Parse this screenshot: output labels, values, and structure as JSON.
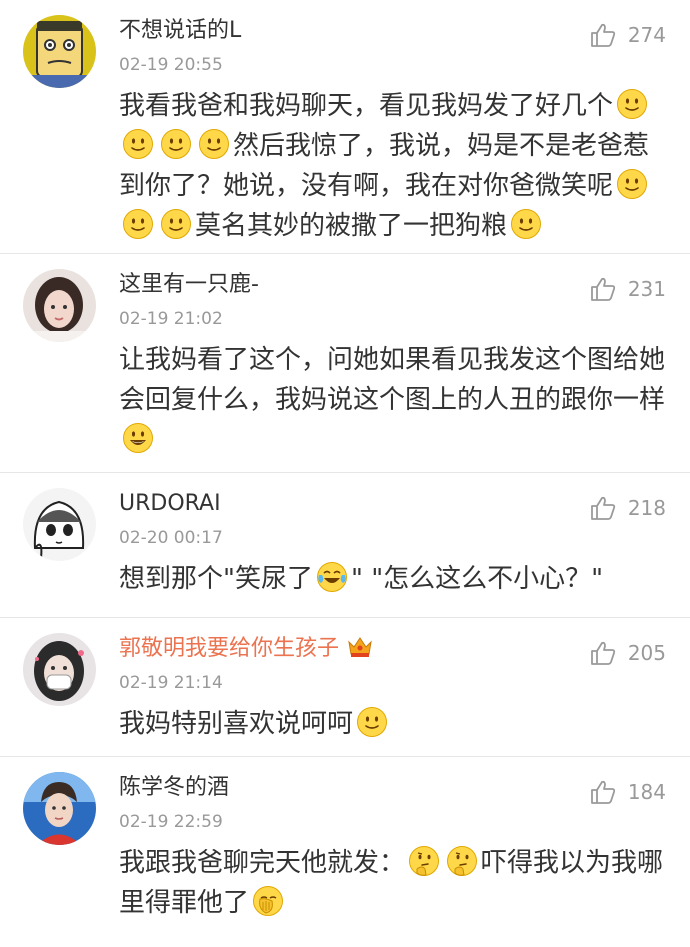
{
  "comments": [
    {
      "username": "不想说话的L",
      "time": "02-19 20:55",
      "likes": "274",
      "avatar_icon": "cartoon-face-avatar",
      "segments": [
        {
          "t": "我看我爸和我妈聊天，看见我妈发了好几个"
        },
        {
          "e": "smile"
        },
        {
          "e": "smile"
        },
        {
          "e": "smile"
        },
        {
          "e": "smile"
        },
        {
          "t": "然后我惊了，我说，妈是不是老爸惹到你了？她说，没有啊，我在对你爸微笑呢"
        },
        {
          "e": "smile"
        },
        {
          "e": "smile"
        },
        {
          "e": "smile"
        },
        {
          "t": "莫名其妙的被撒了一把狗粮"
        },
        {
          "e": "smile"
        }
      ]
    },
    {
      "username": "这里有一只鹿-",
      "time": "02-19 21:02",
      "likes": "231",
      "avatar_icon": "girl-photo-avatar",
      "segments": [
        {
          "t": "让我妈看了这个，问她如果看见我发这个图给她会回复什么，我妈说这个图上的人丑的跟你一样"
        },
        {
          "e": "grin"
        }
      ]
    },
    {
      "username": "URDORAI",
      "time": "02-20 00:17",
      "likes": "218",
      "avatar_icon": "manga-girl-avatar",
      "segments": [
        {
          "t": "想到那个\"笑尿了"
        },
        {
          "e": "tears-of-joy"
        },
        {
          "t": "\" \"怎么这么不小心？\""
        }
      ]
    },
    {
      "username": "郭敬明我要给你生孩子",
      "time": "02-19 21:14",
      "likes": "205",
      "vip": true,
      "avatar_icon": "masked-girl-avatar",
      "segments": [
        {
          "t": "我妈特别喜欢说呵呵"
        },
        {
          "e": "smile"
        }
      ]
    },
    {
      "username": "陈学冬的酒",
      "time": "02-19 22:59",
      "likes": "184",
      "avatar_icon": "boy-photo-avatar",
      "segments": [
        {
          "t": "我跟我爸聊完天他就发："
        },
        {
          "e": "thinking"
        },
        {
          "e": "thinking"
        },
        {
          "t": "吓得我以为我哪里得罪他了"
        },
        {
          "e": "facepalm"
        }
      ]
    }
  ],
  "colors": {
    "text": "#333333",
    "meta": "#999999",
    "vip_name": "#eb7350",
    "divider": "#e6e6e6"
  }
}
